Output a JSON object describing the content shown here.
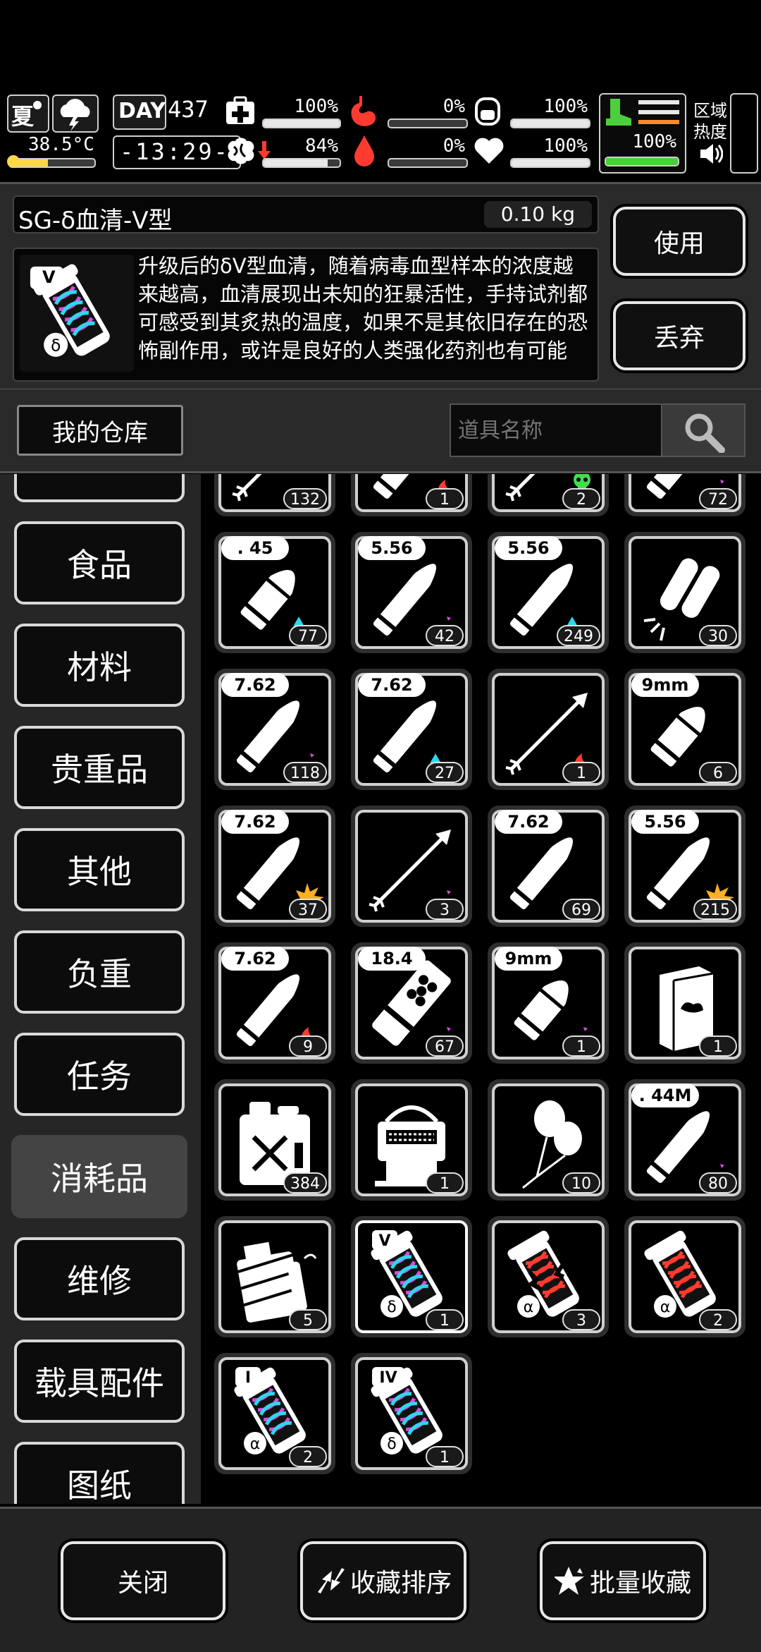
{
  "status": {
    "season": "夏",
    "temperature": "38.5°C",
    "day_label": "DAY",
    "day_number": "437",
    "clock": "-13:29-",
    "health_pct": "100%",
    "hunger_pct": "0%",
    "armor_pct": "100%",
    "sanity_pct": "84%",
    "bleed_pct": "0%",
    "heart_pct": "100%",
    "stamina_pct": "100%",
    "area_heat_label": "区域热度",
    "levels": {
      "temperature": 0.45,
      "health": 1.0,
      "hunger": 0.0,
      "armor": 1.0,
      "sanity": 0.84,
      "bleed": 0.0,
      "heart": 1.0,
      "stamina": 1.0
    }
  },
  "item": {
    "name": "SG-δ血清-V型",
    "weight": "0.10 kg",
    "badge": "V",
    "description": "升级后的δV型血清，随着病毒血型样本的浓度越来越高，血清展现出未知的狂暴活性，手持试剂都可感受到其炙热的温度，如果不是其依旧存在的恐怖副作用，或许是良好的人类强化药剂也有可能",
    "use_label": "使用",
    "discard_label": "丢弃"
  },
  "warehouse": {
    "title": "我的仓库",
    "search_placeholder": "道具名称"
  },
  "categories": [
    "",
    "食品",
    "材料",
    "贵重品",
    "其他",
    "负重",
    "任务",
    "消耗品",
    "维修",
    "载具配件",
    "图纸"
  ],
  "active_category": "消耗品",
  "grid": [
    {
      "icon": "arrow",
      "effect": "",
      "caliber": "",
      "count": "132"
    },
    {
      "icon": "bullet",
      "effect": "fire",
      "caliber": "",
      "count": "1"
    },
    {
      "icon": "arrow",
      "effect": "poison",
      "caliber": "",
      "count": "2"
    },
    {
      "icon": "bullet",
      "effect": "shock",
      "caliber": "",
      "count": "72"
    },
    {
      "icon": "bullet-short",
      "effect": "water",
      "caliber": ". 45",
      "count": "77"
    },
    {
      "icon": "bullet",
      "effect": "shock",
      "caliber": "5.56",
      "count": "42"
    },
    {
      "icon": "bullet",
      "effect": "water",
      "caliber": "5.56",
      "count": "249"
    },
    {
      "icon": "flare",
      "effect": "",
      "caliber": "",
      "count": "30"
    },
    {
      "icon": "bullet",
      "effect": "shock",
      "caliber": "7.62",
      "count": "118"
    },
    {
      "icon": "bullet",
      "effect": "water",
      "caliber": "7.62",
      "count": "27"
    },
    {
      "icon": "arrow",
      "effect": "fire",
      "caliber": "",
      "count": "1"
    },
    {
      "icon": "bullet-short",
      "effect": "",
      "caliber": "9mm",
      "count": "6"
    },
    {
      "icon": "bullet",
      "effect": "explode",
      "caliber": "7.62",
      "count": "37"
    },
    {
      "icon": "arrow",
      "effect": "shock",
      "caliber": "",
      "count": "3"
    },
    {
      "icon": "bullet",
      "effect": "",
      "caliber": "7.62",
      "count": "69"
    },
    {
      "icon": "bullet",
      "effect": "explode",
      "caliber": "5.56",
      "count": "215"
    },
    {
      "icon": "bullet",
      "effect": "fire",
      "caliber": "7.62",
      "count": "9"
    },
    {
      "icon": "shell",
      "effect": "shock",
      "caliber": "18.4",
      "count": "67"
    },
    {
      "icon": "bullet-short",
      "effect": "shock",
      "caliber": "9mm",
      "count": "1"
    },
    {
      "icon": "book",
      "effect": "",
      "caliber": "",
      "count": "1"
    },
    {
      "icon": "jerrycan",
      "effect": "",
      "caliber": "",
      "count": "384"
    },
    {
      "icon": "machine",
      "effect": "",
      "caliber": "",
      "count": "1"
    },
    {
      "icon": "balloon",
      "effect": "",
      "caliber": "",
      "count": "10"
    },
    {
      "icon": "bullet",
      "effect": "shock",
      "caliber": ". 44M",
      "count": "80"
    },
    {
      "icon": "explosive-kit",
      "effect": "",
      "caliber": "",
      "count": "5"
    },
    {
      "icon": "serum",
      "effect": "V-delta",
      "caliber": "",
      "count": "1"
    },
    {
      "icon": "serum-broken",
      "effect": "alpha",
      "caliber": "",
      "count": "3"
    },
    {
      "icon": "serum-red",
      "effect": "alpha",
      "caliber": "",
      "count": "2"
    },
    {
      "icon": "serum",
      "effect": "I-alpha",
      "caliber": "",
      "count": "2"
    },
    {
      "icon": "serum",
      "effect": "IV-delta",
      "caliber": "",
      "count": "1"
    }
  ],
  "footer": {
    "close_label": "关闭",
    "sort_label": "收藏排序",
    "batch_label": "批量收藏"
  },
  "colors": {
    "fire": "#ff3b2f",
    "water": "#2fd6f0",
    "shock": "#d64ce0",
    "poison": "#3fe04a",
    "explode": "#ffb020",
    "stamina": "#4ccf3c"
  }
}
